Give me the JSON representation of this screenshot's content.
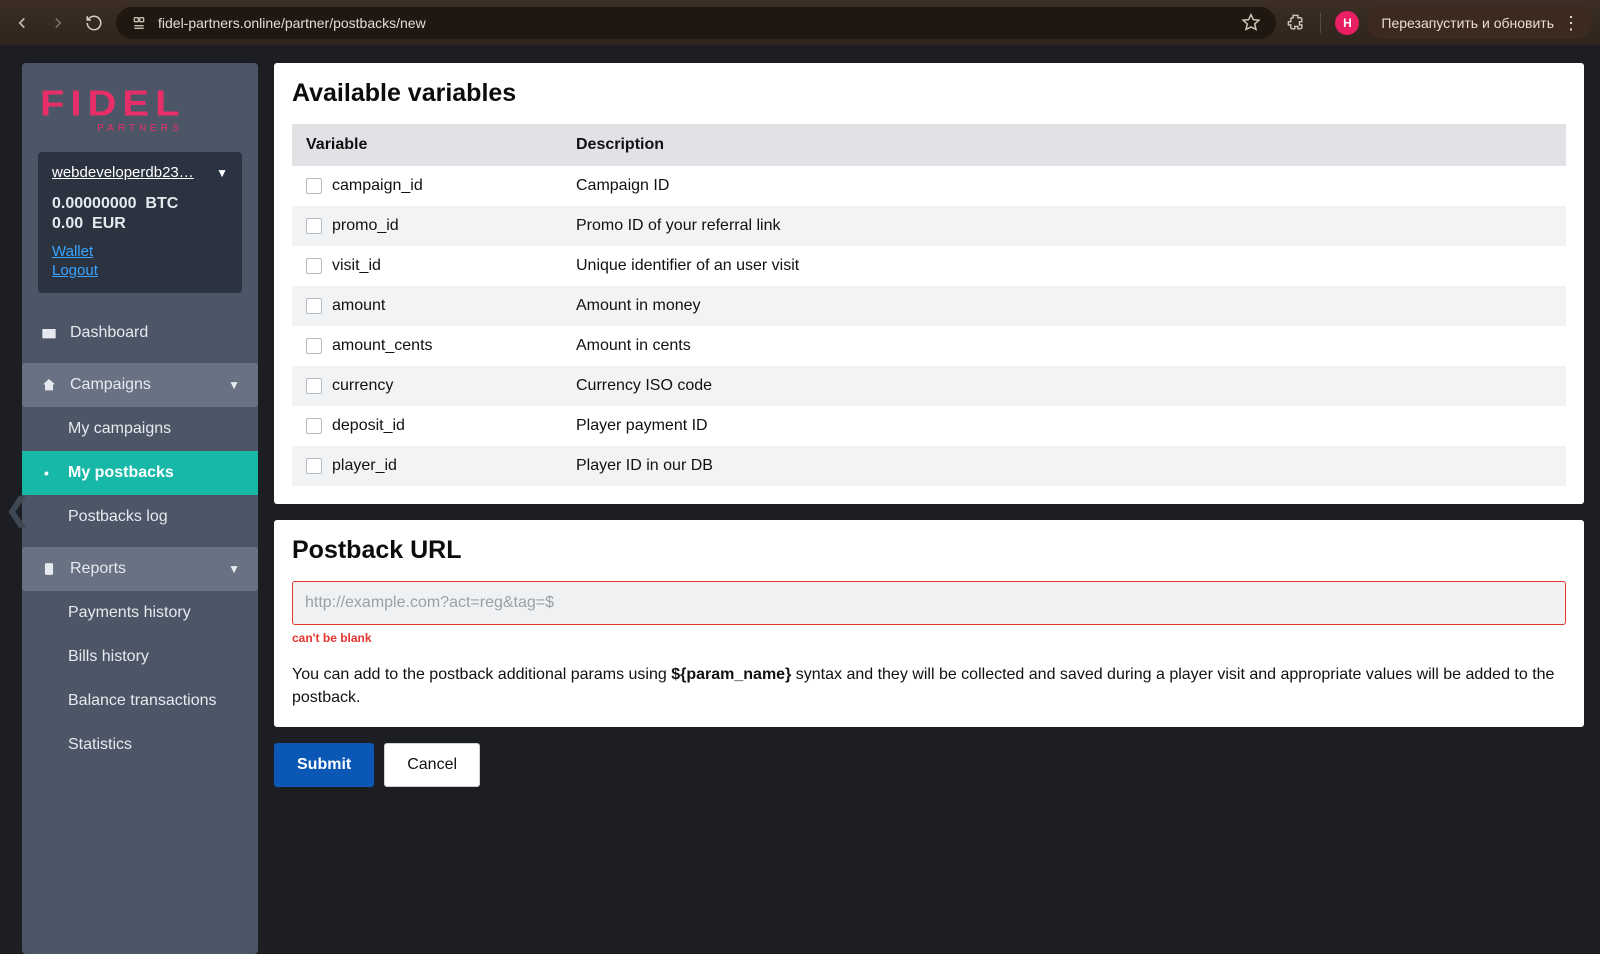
{
  "browser": {
    "url": "fidel-partners.online/partner/postbacks/new",
    "avatar_initial": "Н",
    "update_button": "Перезапустить и обновить"
  },
  "logo": {
    "main": "FIDEL",
    "sub": "PARTNERS"
  },
  "user": {
    "name": "webdeveloperdb23…",
    "btc_amount": "0.00000000",
    "btc_label": "BTC",
    "eur_amount": "0.00",
    "eur_label": "EUR",
    "wallet": "Wallet",
    "logout": "Logout"
  },
  "nav": {
    "dashboard": "Dashboard",
    "campaigns": "Campaigns",
    "campaigns_items": {
      "my_campaigns": "My campaigns",
      "my_postbacks": "My postbacks",
      "postbacks_log": "Postbacks log"
    },
    "reports": "Reports",
    "reports_items": {
      "payments_history": "Payments history",
      "bills_history": "Bills history",
      "balance_transactions": "Balance transactions",
      "statistics": "Statistics"
    }
  },
  "vars_card": {
    "title": "Available variables",
    "head_variable": "Variable",
    "head_description": "Description",
    "rows": [
      {
        "name": "campaign_id",
        "desc": "Campaign ID"
      },
      {
        "name": "promo_id",
        "desc": "Promo ID of your referral link"
      },
      {
        "name": "visit_id",
        "desc": "Unique identifier of an user visit"
      },
      {
        "name": "amount",
        "desc": "Amount in money"
      },
      {
        "name": "amount_cents",
        "desc": "Amount in cents"
      },
      {
        "name": "currency",
        "desc": "Currency ISO code"
      },
      {
        "name": "deposit_id",
        "desc": "Player payment ID"
      },
      {
        "name": "player_id",
        "desc": "Player ID in our DB"
      }
    ]
  },
  "url_card": {
    "title": "Postback URL",
    "placeholder": "http://example.com?act=reg&tag=$",
    "error": "can't be blank",
    "hint_pre": "You can add to the postback additional params using ",
    "hint_bold": "${param_name}",
    "hint_post": " syntax and they will be collected and saved during a player visit and appropriate values will be added to the postback."
  },
  "buttons": {
    "submit": "Submit",
    "cancel": "Cancel"
  }
}
